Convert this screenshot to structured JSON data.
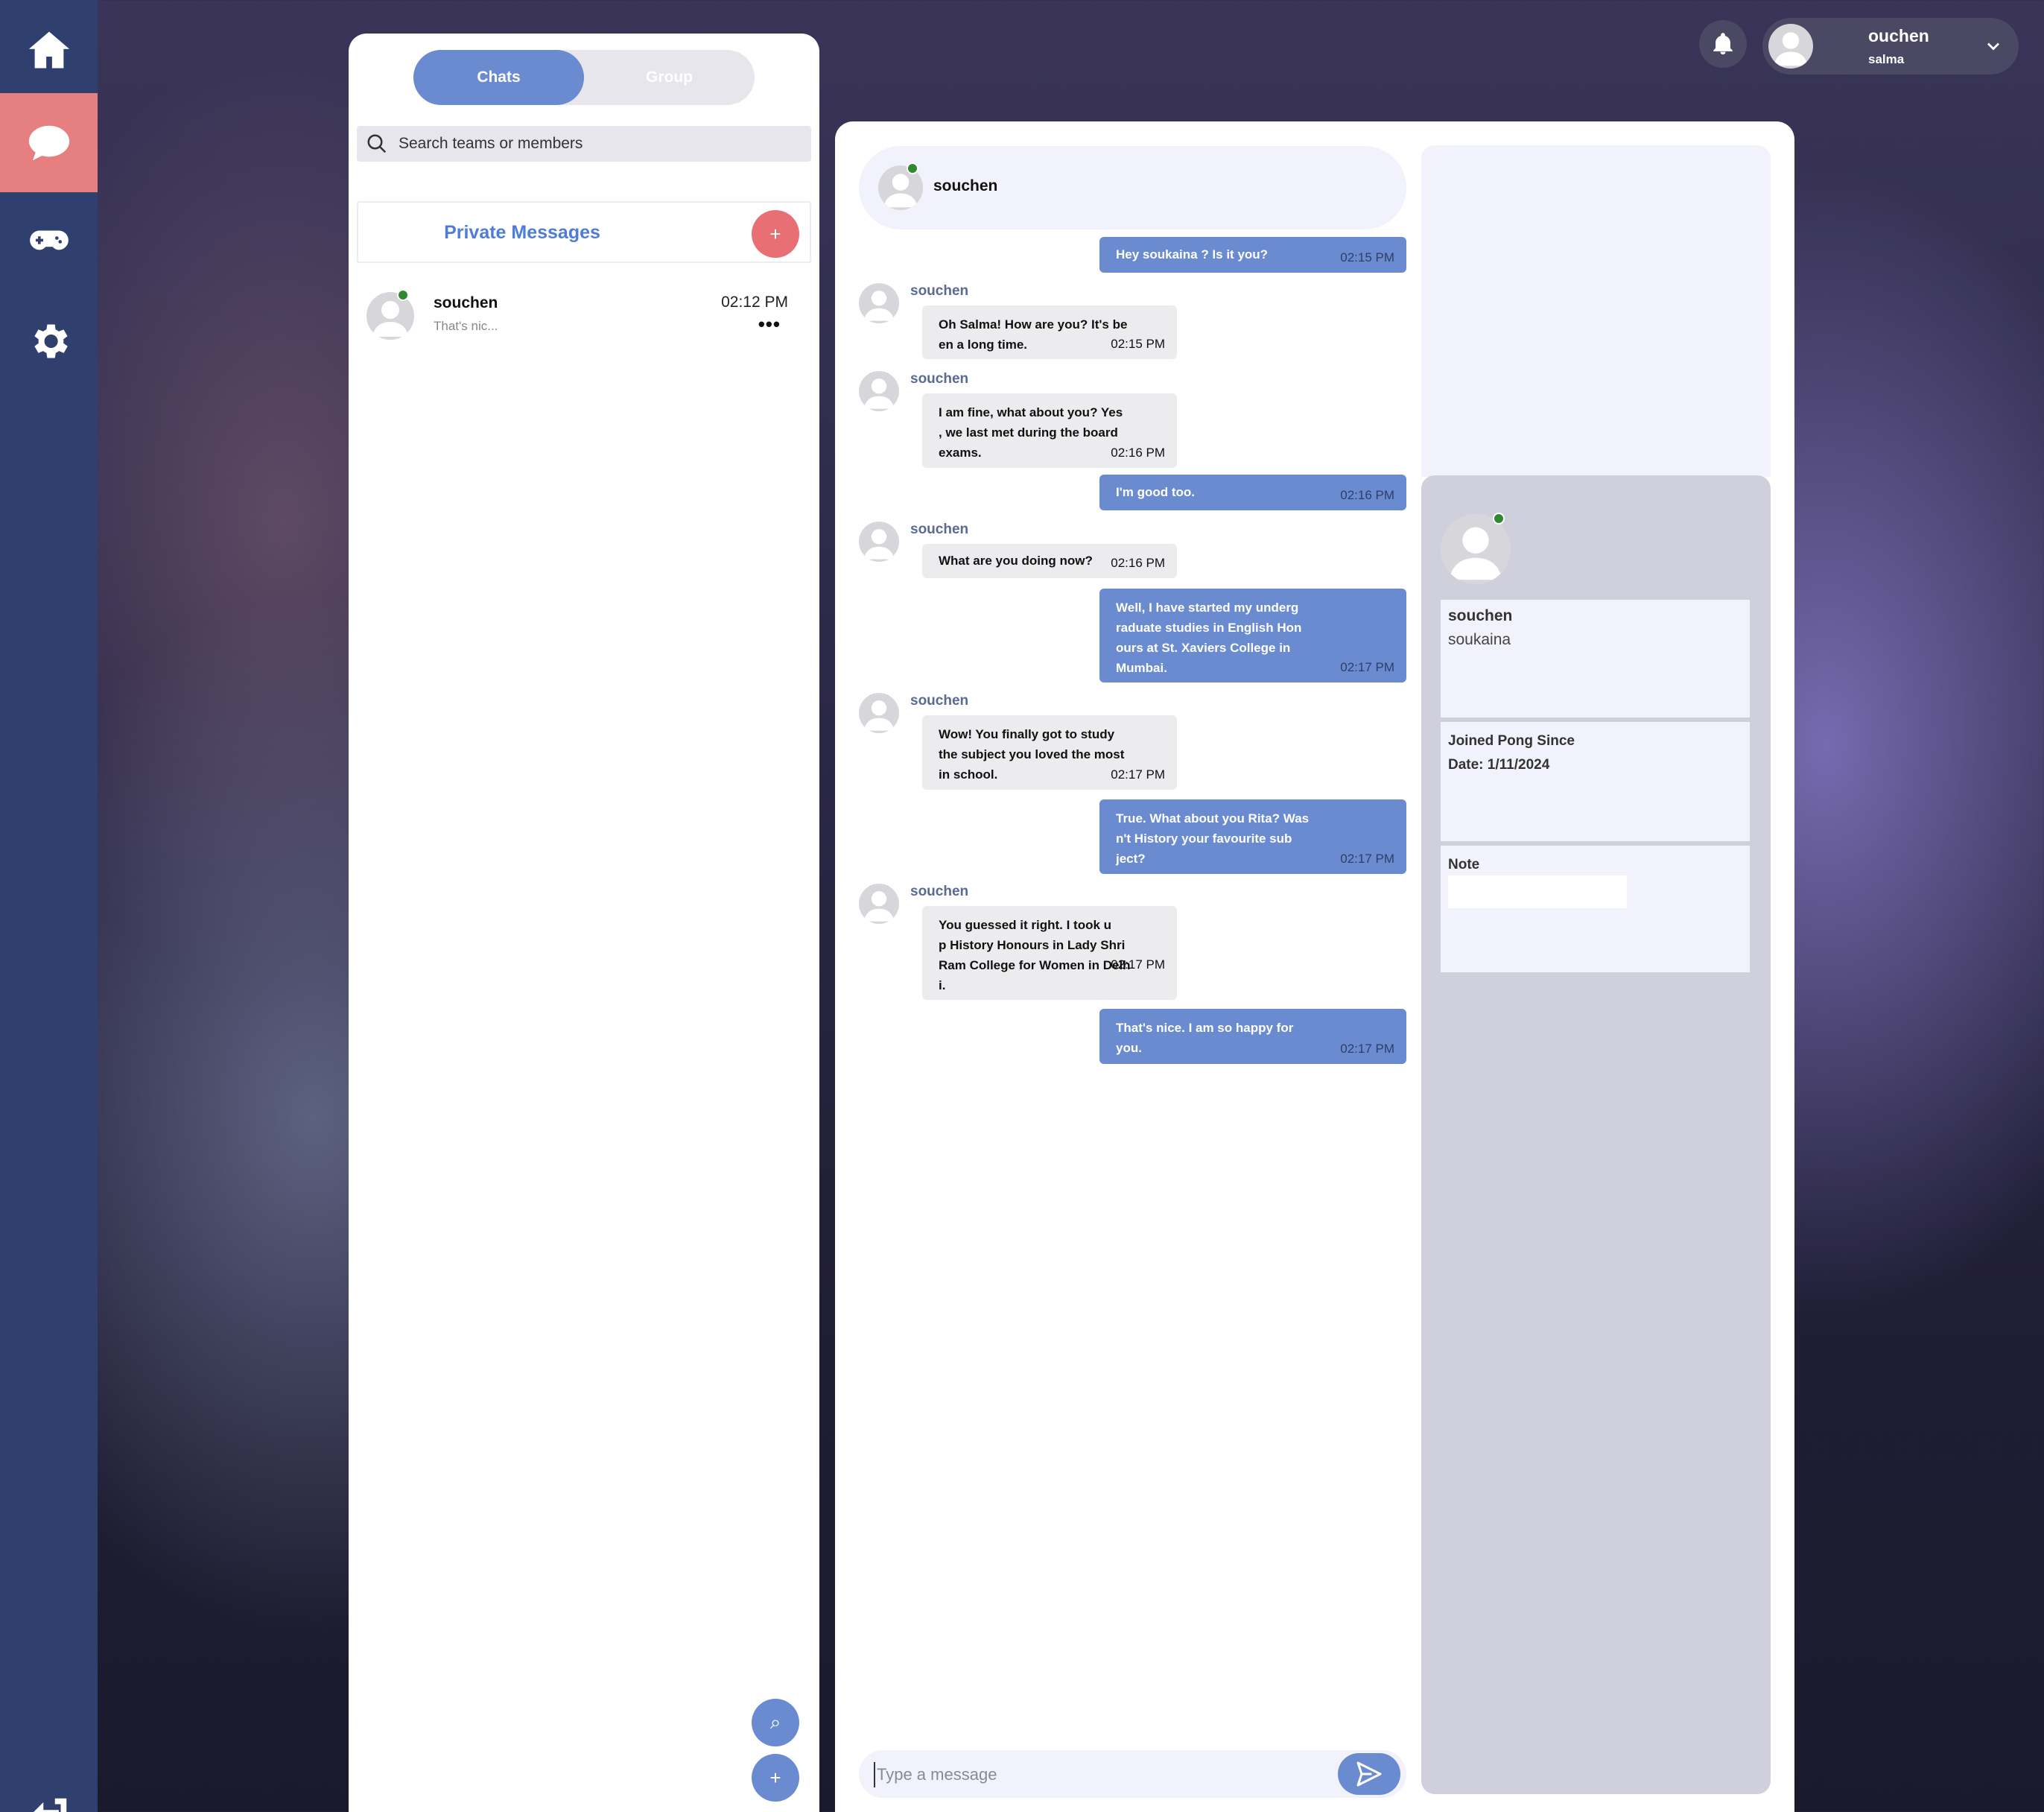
{
  "nav": {
    "items": [
      {
        "name": "home",
        "icon": "home-icon"
      },
      {
        "name": "chat",
        "icon": "chat-bubble-icon",
        "active": true
      },
      {
        "name": "game",
        "icon": "gamepad-icon"
      },
      {
        "name": "settings",
        "icon": "gear-icon"
      },
      {
        "name": "logout",
        "icon": "logout-icon"
      }
    ]
  },
  "list": {
    "tabs": {
      "chats": "Chats",
      "group": "Group"
    },
    "search_placeholder": "Search teams or members",
    "private_title": "Private Messages",
    "add_label": "+",
    "conversations": [
      {
        "name": "souchen",
        "preview": "That's nic...",
        "time": "02:12 PM",
        "more": "•••"
      }
    ],
    "fab_search": "⌕",
    "fab_add": "+"
  },
  "chat": {
    "header_name": "souchen",
    "messages": [
      {
        "dir": "out",
        "text": "Hey soukaina ? Is it you?",
        "time": "02:15 PM"
      },
      {
        "dir": "in",
        "sender": "souchen",
        "lines": [
          "Oh Salma! How are you? It's be",
          "en a long time."
        ],
        "time": "02:15 PM"
      },
      {
        "dir": "in",
        "sender": "souchen",
        "lines": [
          "I am fine, what about you? Yes",
          ", we last met during the board",
          "exams."
        ],
        "time": "02:16 PM"
      },
      {
        "dir": "out",
        "text": "I'm good too.",
        "time": "02:16 PM"
      },
      {
        "dir": "in",
        "sender": "souchen",
        "lines": [
          "What are you doing now?"
        ],
        "time": "02:16 PM"
      },
      {
        "dir": "out",
        "lines": [
          "Well, I have started my underg",
          "raduate studies in English Hon",
          "ours at St. Xaviers College in",
          "Mumbai."
        ],
        "time": "02:17 PM"
      },
      {
        "dir": "in",
        "sender": "souchen",
        "lines": [
          "Wow! You finally got to study",
          "the subject you loved the most",
          "in school."
        ],
        "time": "02:17 PM"
      },
      {
        "dir": "out",
        "lines": [
          "True. What about you Rita? Was",
          "n't History your favourite sub",
          "ject?"
        ],
        "time": "02:17 PM"
      },
      {
        "dir": "in",
        "sender": "souchen",
        "lines": [
          "You guessed it right. I took u",
          "p History Honours in Lady Shri",
          "Ram College for Women in Delh",
          "i."
        ],
        "time": "02:17 PM"
      },
      {
        "dir": "out",
        "lines": [
          "That's nice. I am so happy for",
          "you."
        ],
        "time": "02:17 PM"
      }
    ],
    "composer_placeholder": "Type a message"
  },
  "info": {
    "name": "souchen",
    "username": "soukaina",
    "joined_label": "Joined Pong Since",
    "joined_date": "Date: 1/11/2024",
    "note_label": "Note"
  },
  "topbar": {
    "user_name": "ouchen",
    "user_sub": "salma"
  },
  "colors": {
    "accent": "#6a8bd0",
    "active_nav": "#e57f80",
    "online": "#2f8a2f",
    "nav_bg": "#2f3f6e"
  }
}
